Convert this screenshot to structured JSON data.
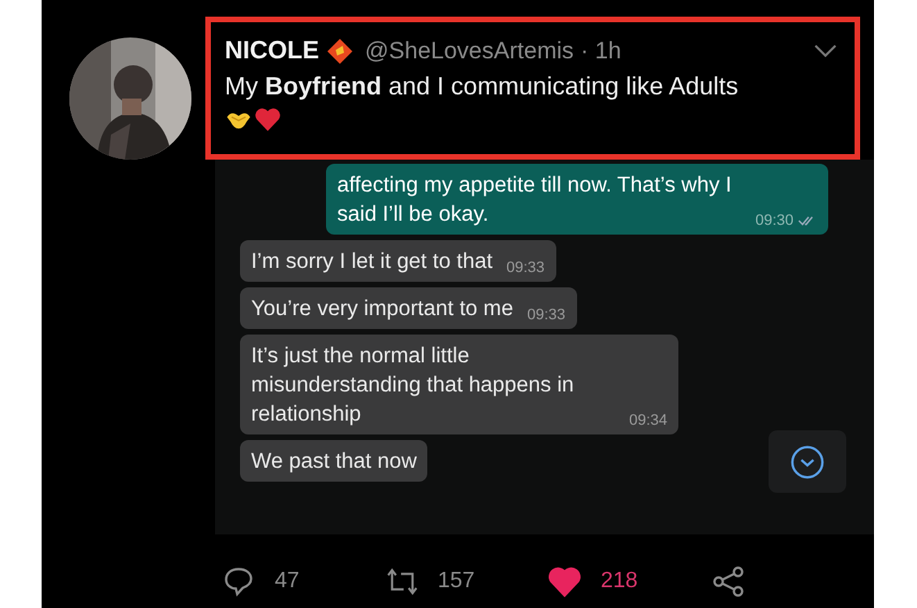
{
  "tweet": {
    "author": "NICOLE",
    "handle": "@SheLovesArtemis",
    "time": "· 1h",
    "text": "My **Boyfriend** and I communicating like Adults",
    "highlighted": true
  },
  "chat": {
    "messages": [
      {
        "kind": "outgoing",
        "text": "affecting my appetite till now. That’s why I said I’ll be okay.",
        "time": "09:30",
        "read": true
      },
      {
        "kind": "incoming",
        "text": "I’m sorry I let it get to that",
        "time": "09:33"
      },
      {
        "kind": "incoming",
        "text": "You’re very important to me",
        "time": "09:33"
      },
      {
        "kind": "incoming",
        "text": "It’s just the normal little misunderstanding that happens in relationship",
        "time": "09:34"
      },
      {
        "kind": "incoming",
        "text": "We past that now"
      }
    ]
  },
  "actions": [
    {
      "kind": "reply",
      "count": "47"
    },
    {
      "kind": "retweet",
      "count": "157"
    },
    {
      "kind": "like",
      "count": "218",
      "selected": true
    },
    {
      "kind": "share"
    }
  ]
}
